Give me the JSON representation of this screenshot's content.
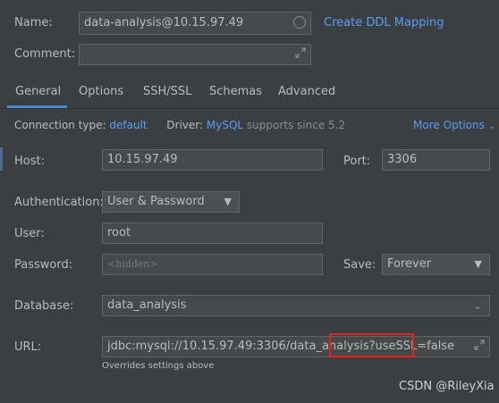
{
  "name": {
    "label": "Name:",
    "value": "data-analysis@10.15.97.49",
    "ddl_link": "Create DDL Mapping"
  },
  "comment": {
    "label": "Comment:",
    "value": ""
  },
  "tabs": [
    {
      "label": "General",
      "active": true
    },
    {
      "label": "Options"
    },
    {
      "label": "SSH/SSL"
    },
    {
      "label": "Schemas"
    },
    {
      "label": "Advanced"
    }
  ],
  "info": {
    "conn_type_label": "Connection type:",
    "conn_type_value": "default",
    "driver_label": "Driver:",
    "driver_value": "MySQL",
    "driver_note": "supports since 5.2",
    "more_options": "More Options"
  },
  "host": {
    "label": "Host:",
    "value": "10.15.97.49"
  },
  "port": {
    "label": "Port:",
    "value": "3306"
  },
  "auth": {
    "label": "Authentication:",
    "value": "User & Password"
  },
  "user": {
    "label": "User:",
    "value": "root"
  },
  "password": {
    "label": "Password:",
    "placeholder": "<hidden>"
  },
  "save": {
    "label": "Save:",
    "value": "Forever"
  },
  "database": {
    "label": "Database:",
    "value": "data_analysis"
  },
  "url": {
    "label": "URL:",
    "value_base": "jdbc:mysql://10.15.97.49:3306/data_analysis?",
    "value_param": "useSSL=false",
    "hint": "Overrides settings above"
  },
  "watermark": "CSDN @RileyXia",
  "colors": {
    "background": "#3c3f41",
    "link": "#589df6",
    "tab_underline": "#4a88c7",
    "highlight_box": "#e3241b"
  }
}
